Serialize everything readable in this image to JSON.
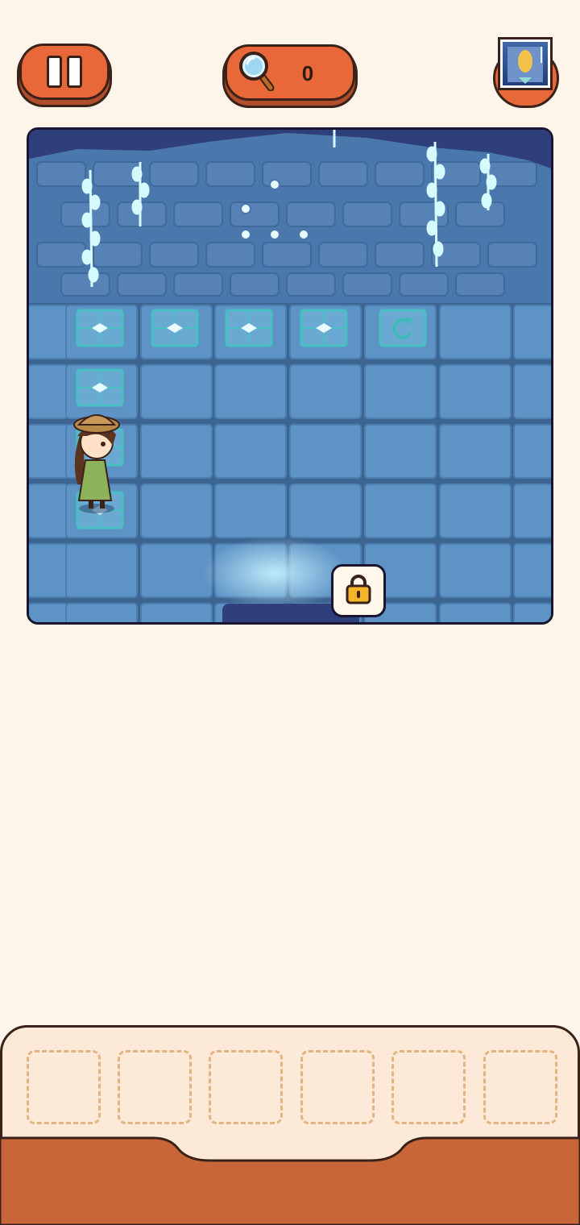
{
  "hud": {
    "pause_icon": "pause-icon",
    "hint_icon": "magnifier-icon",
    "hint_count": "0",
    "photo_icon": "photo-thumbnail"
  },
  "scene": {
    "lock_icon": "padlock-icon",
    "colors": {
      "wall": "#4a78ad",
      "floor": "#5e93c6",
      "tile_border": "#3d6592",
      "glow": "#d6fbff"
    }
  },
  "inventory": {
    "slot_count": 6,
    "colors": {
      "panel": "#fde9d8",
      "base": "#c8663a",
      "slot_border": "#e2b481"
    }
  }
}
